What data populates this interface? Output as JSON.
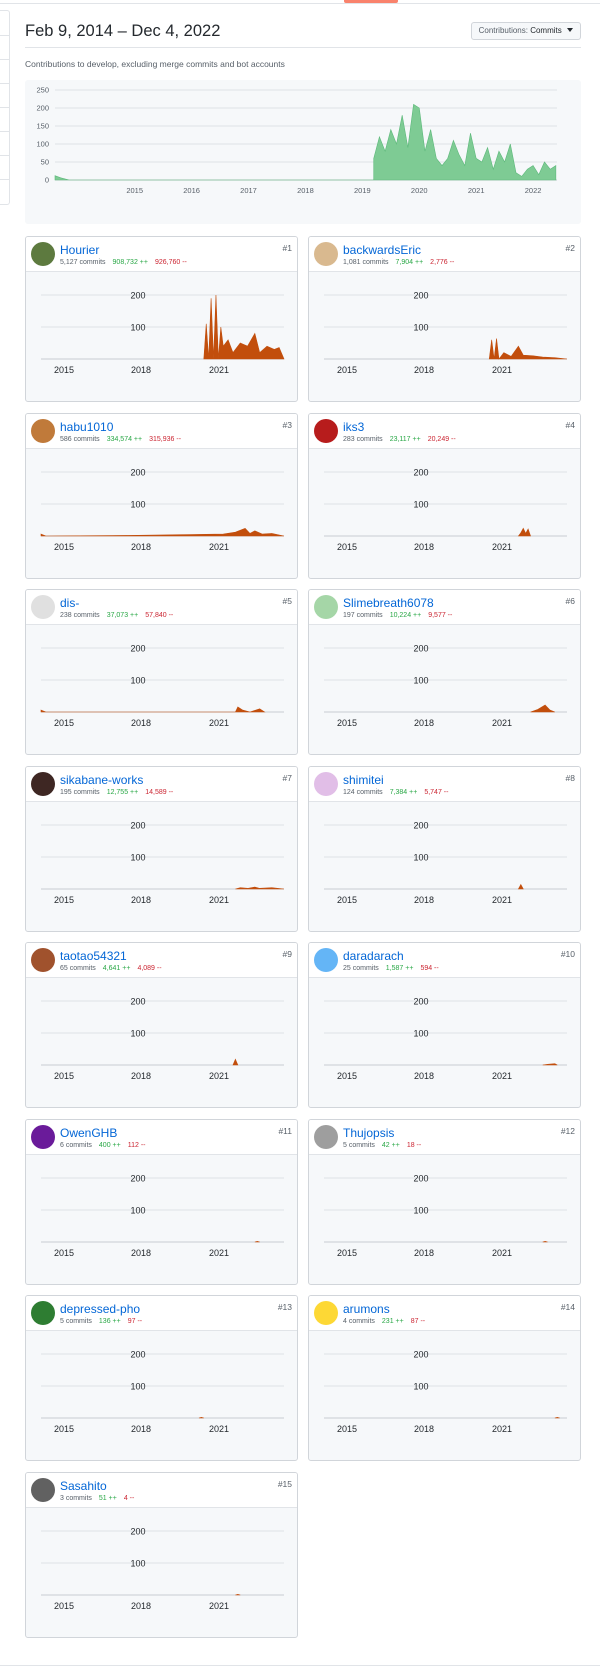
{
  "page": {
    "date_range": "Feb 9, 2014 – Dec 4, 2022",
    "subtitle": "Contributions to develop, excluding merge commits and bot accounts",
    "select": {
      "label": "Contributions:",
      "value": "Commits"
    },
    "colors": {
      "overview_area": "#7ecb94",
      "contributor_area": "#c24e0c",
      "link": "#0366d6",
      "additions": "#28a745",
      "deletions": "#cb2431"
    }
  },
  "chart_data": [
    {
      "type": "area",
      "name": "overview",
      "yticks": [
        0,
        50,
        100,
        150,
        200,
        250
      ],
      "xticks": [
        "2015",
        "2016",
        "2017",
        "2018",
        "2019",
        "2020",
        "2021",
        "2022"
      ],
      "ylim": [
        0,
        250
      ],
      "grid": true,
      "series": [
        {
          "x": [
            2014.1,
            2014.2,
            2014.35,
            2019.7,
            2019.8,
            2019.9,
            2020.0,
            2020.1,
            2020.2,
            2020.3,
            2020.4,
            2020.5,
            2020.6,
            2020.7,
            2020.8,
            2020.9,
            2021.0,
            2021.1,
            2021.2,
            2021.3,
            2021.4,
            2021.5,
            2021.6,
            2021.7,
            2021.8,
            2021.9,
            2022.0,
            2022.1,
            2022.2,
            2022.3,
            2022.4,
            2022.5,
            2022.6,
            2022.7,
            2022.8,
            2022.9
          ],
          "y": [
            12,
            6,
            0,
            60,
            120,
            80,
            140,
            100,
            180,
            90,
            210,
            200,
            80,
            140,
            60,
            40,
            60,
            110,
            70,
            40,
            130,
            60,
            50,
            90,
            30,
            80,
            50,
            100,
            20,
            10,
            30,
            40,
            15,
            50,
            30,
            40
          ]
        }
      ]
    }
  ],
  "contributor_chart": {
    "yticks": [
      "100",
      "200"
    ],
    "xticks": [
      "2015",
      "2018",
      "2021"
    ]
  },
  "contributors": [
    {
      "rank": "#1",
      "login": "Hourier",
      "commits": "5,127 commits",
      "additions": "908,732 ++",
      "deletions": "926,760 --",
      "avatar": "#5d7a3f"
    },
    {
      "rank": "#2",
      "login": "backwardsEric",
      "commits": "1,081 commits",
      "additions": "7,904 ++",
      "deletions": "2,776 --",
      "avatar": "#d9b98f"
    },
    {
      "rank": "#3",
      "login": "habu1010",
      "commits": "586 commits",
      "additions": "334,574 ++",
      "deletions": "315,936 --",
      "avatar": "#c07a3a"
    },
    {
      "rank": "#4",
      "login": "iks3",
      "commits": "283 commits",
      "additions": "23,117 ++",
      "deletions": "20,249 --",
      "avatar": "#b71c1c"
    },
    {
      "rank": "#5",
      "login": "dis-",
      "commits": "238 commits",
      "additions": "37,073 ++",
      "deletions": "57,840 --",
      "avatar": "#e0e0e0"
    },
    {
      "rank": "#6",
      "login": "Slimebreath6078",
      "commits": "197 commits",
      "additions": "10,224 ++",
      "deletions": "9,577 --",
      "avatar": "#a5d6a7"
    },
    {
      "rank": "#7",
      "login": "sikabane-works",
      "commits": "195 commits",
      "additions": "12,755 ++",
      "deletions": "14,589 --",
      "avatar": "#3e2723"
    },
    {
      "rank": "#8",
      "login": "shimitei",
      "commits": "124 commits",
      "additions": "7,384 ++",
      "deletions": "5,747 --",
      "avatar": "#e1bee7"
    },
    {
      "rank": "#9",
      "login": "taotao54321",
      "commits": "65 commits",
      "additions": "4,641 ++",
      "deletions": "4,089 --",
      "avatar": "#a0522d"
    },
    {
      "rank": "#10",
      "login": "daradarach",
      "commits": "25 commits",
      "additions": "1,587 ++",
      "deletions": "594 --",
      "avatar": "#64b5f6"
    },
    {
      "rank": "#11",
      "login": "OwenGHB",
      "commits": "6 commits",
      "additions": "400 ++",
      "deletions": "112 --",
      "avatar": "#6a1b9a"
    },
    {
      "rank": "#12",
      "login": "Thujopsis",
      "commits": "5 commits",
      "additions": "42 ++",
      "deletions": "18 --",
      "avatar": "#9e9e9e"
    },
    {
      "rank": "#13",
      "login": "depressed-pho",
      "commits": "5 commits",
      "additions": "136 ++",
      "deletions": "97 --",
      "avatar": "#2e7d32"
    },
    {
      "rank": "#14",
      "login": "arumons",
      "commits": "4 commits",
      "additions": "231 ++",
      "deletions": "87 --",
      "avatar": "#fdd835"
    },
    {
      "rank": "#15",
      "login": "Sasahito",
      "commits": "3 commits",
      "additions": "51 ++",
      "deletions": "4 --",
      "avatar": "#616161"
    }
  ]
}
